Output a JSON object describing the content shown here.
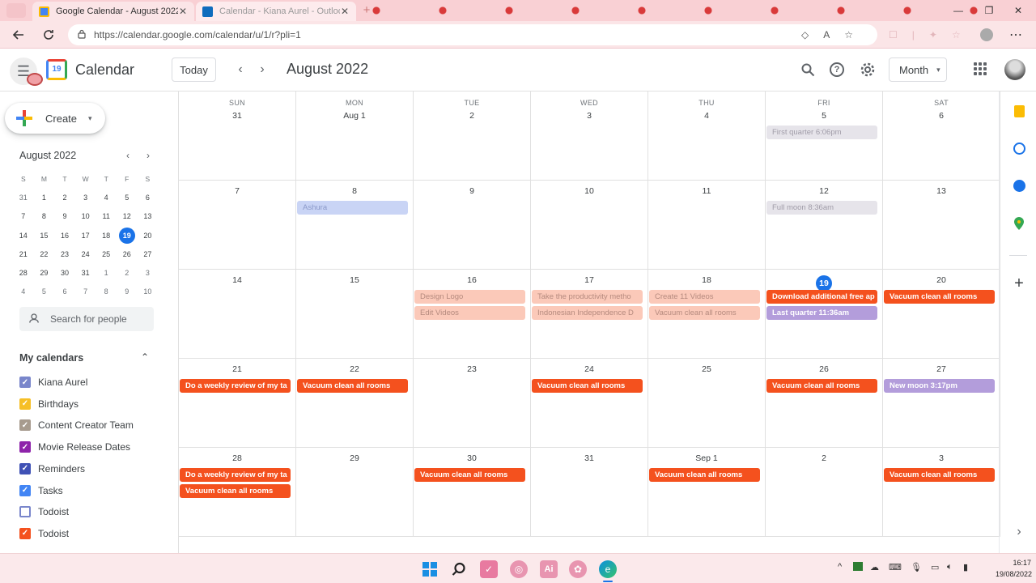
{
  "browser": {
    "tabs": [
      {
        "title": "Google Calendar - August 2022",
        "close": "✕"
      },
      {
        "title": "Calendar - Kiana Aurel - Outlook",
        "close": "✕"
      }
    ],
    "new_tab": "+",
    "url": "https://calendar.google.com/calendar/u/1/r?pli=1",
    "window_controls": {
      "minimize": "—",
      "restore": "❐",
      "close": "✕"
    }
  },
  "header": {
    "logo_day": "19",
    "app_name": "Calendar",
    "today_label": "Today",
    "prev": "‹",
    "next": "›",
    "current_period": "August 2022",
    "view_label": "Month",
    "view_caret": "▾"
  },
  "sidebar": {
    "create_label": "Create",
    "create_caret": "▾",
    "mini_cal": {
      "title": "August 2022",
      "prev": "‹",
      "next": "›",
      "weekday_headers": [
        "S",
        "M",
        "T",
        "W",
        "T",
        "F",
        "S"
      ],
      "today": "19",
      "weeks": [
        [
          "31",
          "1",
          "2",
          "3",
          "4",
          "5",
          "6"
        ],
        [
          "7",
          "8",
          "9",
          "10",
          "11",
          "12",
          "13"
        ],
        [
          "14",
          "15",
          "16",
          "17",
          "18",
          "19",
          "20"
        ],
        [
          "21",
          "22",
          "23",
          "24",
          "25",
          "26",
          "27"
        ],
        [
          "28",
          "29",
          "30",
          "31",
          "1",
          "2",
          "3"
        ],
        [
          "4",
          "5",
          "6",
          "7",
          "8",
          "9",
          "10"
        ]
      ]
    },
    "people_search_placeholder": "Search for people",
    "my_calendars_title": "My calendars",
    "my_calendars_caret": "⌃",
    "calendars": [
      {
        "label": "Kiana Aurel",
        "color": "#7986cb",
        "checked": true
      },
      {
        "label": "Birthdays",
        "color": "#f6bf26",
        "checked": true
      },
      {
        "label": "Content Creator Team",
        "color": "#a79b8e",
        "checked": true
      },
      {
        "label": "Movie Release Dates",
        "color": "#8e24aa",
        "checked": true
      },
      {
        "label": "Reminders",
        "color": "#3f51b5",
        "checked": true
      },
      {
        "label": "Tasks",
        "color": "#4285f4",
        "checked": true
      },
      {
        "label": "Todoist",
        "color": "#7986cb",
        "checked": false
      },
      {
        "label": "Todoist",
        "color": "#f4511e",
        "checked": true
      }
    ]
  },
  "month_view": {
    "weekdays": [
      "SUN",
      "MON",
      "TUE",
      "WED",
      "THU",
      "FRI",
      "SAT"
    ],
    "today": "19",
    "weeks": [
      [
        {
          "day": "31",
          "events": []
        },
        {
          "day": "Aug 1",
          "events": []
        },
        {
          "day": "2",
          "events": []
        },
        {
          "day": "3",
          "events": []
        },
        {
          "day": "4",
          "events": []
        },
        {
          "day": "5",
          "events": [
            {
              "title": "First quarter 6:06pm",
              "style": "muted-gray"
            }
          ]
        },
        {
          "day": "6",
          "events": []
        }
      ],
      [
        {
          "day": "7",
          "events": []
        },
        {
          "day": "8",
          "events": [
            {
              "title": "Ashura",
              "style": "muted-blue"
            }
          ]
        },
        {
          "day": "9",
          "events": []
        },
        {
          "day": "10",
          "events": []
        },
        {
          "day": "11",
          "events": []
        },
        {
          "day": "12",
          "events": [
            {
              "title": "Full moon 8:36am",
              "style": "muted-gray"
            }
          ]
        },
        {
          "day": "13",
          "events": []
        }
      ],
      [
        {
          "day": "14",
          "events": []
        },
        {
          "day": "15",
          "events": []
        },
        {
          "day": "16",
          "events": [
            {
              "title": "Design Logo",
              "style": "muted-orange"
            },
            {
              "title": "Edit Videos",
              "style": "muted-orange"
            }
          ]
        },
        {
          "day": "17",
          "events": [
            {
              "title": "Take the productivity metho",
              "style": "muted-orange"
            },
            {
              "title": "Indonesian Independence D",
              "style": "muted-orange"
            }
          ]
        },
        {
          "day": "18",
          "events": [
            {
              "title": "Create 11 Videos",
              "style": "muted-orange"
            },
            {
              "title": "Vacuum clean all rooms",
              "style": "muted-orange"
            }
          ]
        },
        {
          "day": "19",
          "events": [
            {
              "title": "Download additional free ap",
              "style": "orange"
            },
            {
              "title": "Last quarter 11:36am",
              "style": "purple"
            }
          ]
        },
        {
          "day": "20",
          "events": [
            {
              "title": "Vacuum clean all rooms",
              "style": "orange"
            }
          ]
        }
      ],
      [
        {
          "day": "21",
          "events": [
            {
              "title": "Do a weekly review of my ta",
              "style": "orange"
            }
          ]
        },
        {
          "day": "22",
          "events": [
            {
              "title": "Vacuum clean all rooms",
              "style": "orange"
            }
          ]
        },
        {
          "day": "23",
          "events": []
        },
        {
          "day": "24",
          "events": [
            {
              "title": "Vacuum clean all rooms",
              "style": "orange"
            }
          ]
        },
        {
          "day": "25",
          "events": []
        },
        {
          "day": "26",
          "events": [
            {
              "title": "Vacuum clean all rooms",
              "style": "orange"
            }
          ]
        },
        {
          "day": "27",
          "events": [
            {
              "title": "New moon 3:17pm",
              "style": "purple"
            }
          ]
        }
      ],
      [
        {
          "day": "28",
          "events": [
            {
              "title": "Do a weekly review of my ta",
              "style": "orange"
            },
            {
              "title": "Vacuum clean all rooms",
              "style": "orange"
            }
          ]
        },
        {
          "day": "29",
          "events": []
        },
        {
          "day": "30",
          "events": [
            {
              "title": "Vacuum clean all rooms",
              "style": "orange"
            }
          ]
        },
        {
          "day": "31",
          "events": []
        },
        {
          "day": "Sep 1",
          "events": [
            {
              "title": "Vacuum clean all rooms",
              "style": "orange"
            }
          ]
        },
        {
          "day": "2",
          "events": []
        },
        {
          "day": "3",
          "events": [
            {
              "title": "Vacuum clean all rooms",
              "style": "orange"
            }
          ]
        }
      ]
    ]
  },
  "event_styles": {
    "orange": {
      "bg": "#f4511e",
      "fg": "#ffffff"
    },
    "purple": {
      "bg": "#b39ddb",
      "fg": "#ffffff"
    },
    "muted-orange": {
      "bg": "#fbc9b9",
      "fg": "#b58a7e"
    },
    "muted-gray": {
      "bg": "#e6e4ea",
      "fg": "#a09ca8"
    },
    "muted-blue": {
      "bg": "#c9d4f5",
      "fg": "#8b99c9"
    }
  },
  "right_rail": {
    "add": "+",
    "expand": "›"
  },
  "taskbar": {
    "time": "16:17",
    "date": "19/08/2022",
    "tray_caret": "^"
  },
  "colors": {
    "accent": "#1a73e8",
    "browser_tint": "#f9d0d4"
  }
}
